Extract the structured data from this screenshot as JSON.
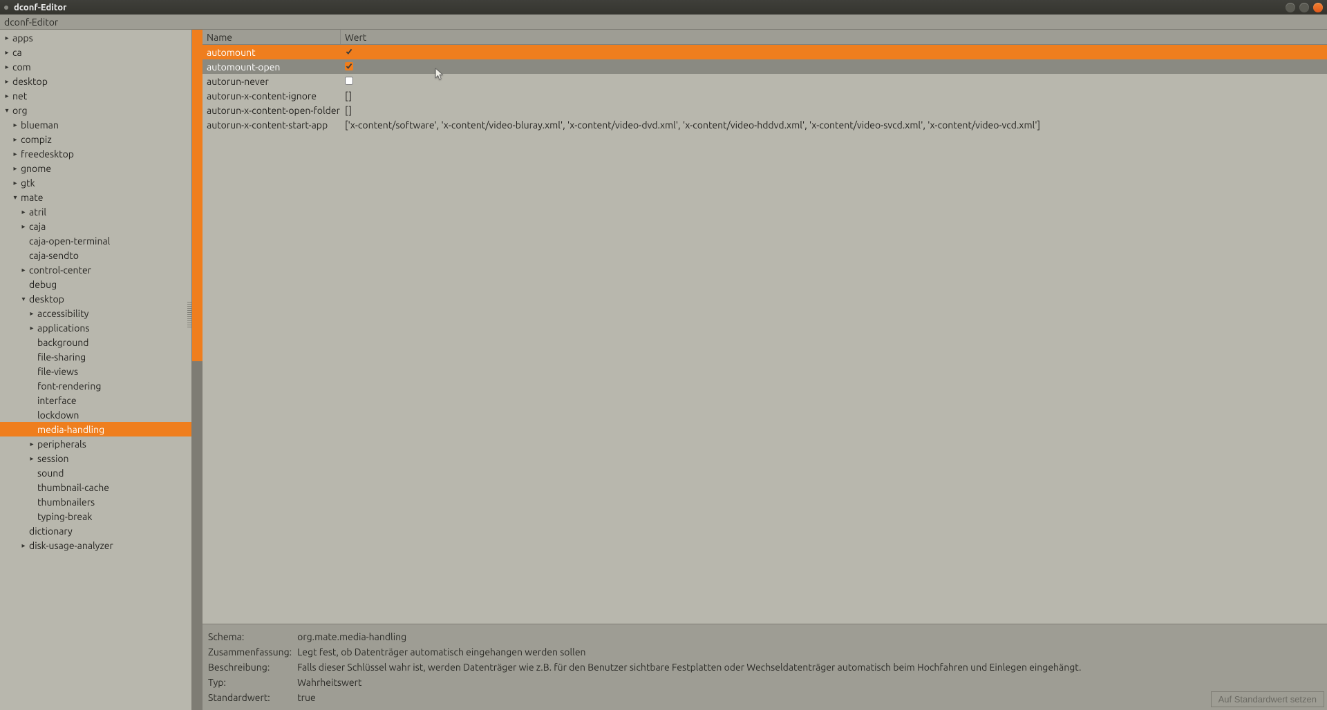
{
  "window": {
    "title": "dconf-Editor"
  },
  "toolbar": {
    "title": "dconf-Editor"
  },
  "tree": [
    {
      "depth": 0,
      "exp": "r",
      "label": "apps"
    },
    {
      "depth": 0,
      "exp": "r",
      "label": "ca"
    },
    {
      "depth": 0,
      "exp": "r",
      "label": "com"
    },
    {
      "depth": 0,
      "exp": "r",
      "label": "desktop"
    },
    {
      "depth": 0,
      "exp": "r",
      "label": "net"
    },
    {
      "depth": 0,
      "exp": "d",
      "label": "org"
    },
    {
      "depth": 1,
      "exp": "r",
      "label": "blueman"
    },
    {
      "depth": 1,
      "exp": "r",
      "label": "compiz"
    },
    {
      "depth": 1,
      "exp": "r",
      "label": "freedesktop"
    },
    {
      "depth": 1,
      "exp": "r",
      "label": "gnome"
    },
    {
      "depth": 1,
      "exp": "r",
      "label": "gtk"
    },
    {
      "depth": 1,
      "exp": "d",
      "label": "mate"
    },
    {
      "depth": 2,
      "exp": "r",
      "label": "atril"
    },
    {
      "depth": 2,
      "exp": "r",
      "label": "caja"
    },
    {
      "depth": 2,
      "exp": "",
      "label": "caja-open-terminal"
    },
    {
      "depth": 2,
      "exp": "",
      "label": "caja-sendto"
    },
    {
      "depth": 2,
      "exp": "r",
      "label": "control-center"
    },
    {
      "depth": 2,
      "exp": "",
      "label": "debug"
    },
    {
      "depth": 2,
      "exp": "d",
      "label": "desktop"
    },
    {
      "depth": 3,
      "exp": "r",
      "label": "accessibility"
    },
    {
      "depth": 3,
      "exp": "r",
      "label": "applications"
    },
    {
      "depth": 3,
      "exp": "",
      "label": "background"
    },
    {
      "depth": 3,
      "exp": "",
      "label": "file-sharing"
    },
    {
      "depth": 3,
      "exp": "",
      "label": "file-views"
    },
    {
      "depth": 3,
      "exp": "",
      "label": "font-rendering"
    },
    {
      "depth": 3,
      "exp": "",
      "label": "interface"
    },
    {
      "depth": 3,
      "exp": "",
      "label": "lockdown"
    },
    {
      "depth": 3,
      "exp": "",
      "label": "media-handling",
      "selected": true
    },
    {
      "depth": 3,
      "exp": "r",
      "label": "peripherals"
    },
    {
      "depth": 3,
      "exp": "r",
      "label": "session"
    },
    {
      "depth": 3,
      "exp": "",
      "label": "sound"
    },
    {
      "depth": 3,
      "exp": "",
      "label": "thumbnail-cache"
    },
    {
      "depth": 3,
      "exp": "",
      "label": "thumbnailers"
    },
    {
      "depth": 3,
      "exp": "",
      "label": "typing-break"
    },
    {
      "depth": 2,
      "exp": "",
      "label": "dictionary"
    },
    {
      "depth": 2,
      "exp": "r",
      "label": "disk-usage-analyzer"
    }
  ],
  "keylist": {
    "headers": {
      "name": "Name",
      "value": "Wert"
    },
    "rows": [
      {
        "name": "automount",
        "type": "bool",
        "value": true,
        "selected": true
      },
      {
        "name": "automount-open",
        "type": "bool",
        "value": true,
        "hover": true
      },
      {
        "name": "autorun-never",
        "type": "bool",
        "value": false
      },
      {
        "name": "autorun-x-content-ignore",
        "type": "text",
        "value": "[]"
      },
      {
        "name": "autorun-x-content-open-folder",
        "type": "text",
        "value": "[]"
      },
      {
        "name": "autorun-x-content-start-app",
        "type": "text",
        "value": "['x-content/software', 'x-content/video-bluray.xml', 'x-content/video-dvd.xml', 'x-content/video-hddvd.xml', 'x-content/video-svcd.xml', 'x-content/video-vcd.xml']"
      }
    ]
  },
  "details": {
    "labels": {
      "schema": "Schema:",
      "summary": "Zusammenfassung:",
      "description": "Beschreibung:",
      "type": "Typ:",
      "default": "Standardwert:"
    },
    "schema": "org.mate.media-handling",
    "summary": "Legt fest, ob Datenträger automatisch eingehangen werden sollen",
    "description": "Falls dieser Schlüssel wahr ist, werden Datenträger wie z.B. für den Benutzer sichtbare Festplatten oder Wechseldatenträger automatisch beim Hochfahren und Einlegen eingehängt.",
    "type": "Wahrheitswert",
    "default": "true",
    "reset_label": "Auf Standardwert setzen"
  }
}
